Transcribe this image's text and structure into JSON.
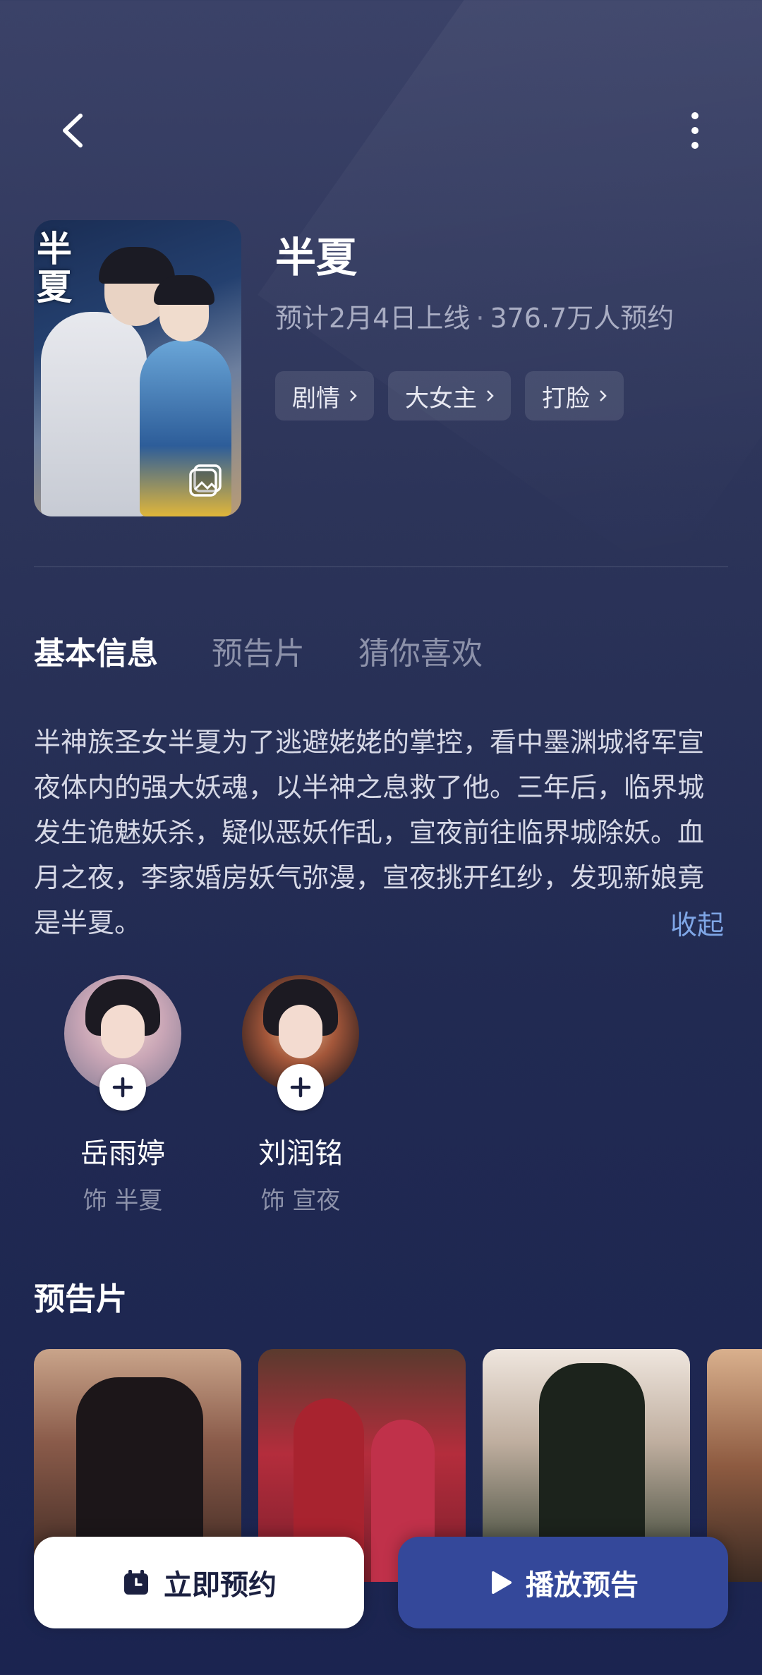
{
  "header": {
    "back_icon": "chevron-left-icon",
    "more_icon": "more-vertical-icon"
  },
  "show": {
    "poster_title": "半夏",
    "title": "半夏",
    "release": "预计2月4日上线",
    "separator": "·",
    "reservations": "376.7万人预约",
    "tags": [
      {
        "label": "剧情"
      },
      {
        "label": "大女主"
      },
      {
        "label": "打脸"
      }
    ]
  },
  "tabs": [
    {
      "label": "基本信息",
      "active": true
    },
    {
      "label": "预告片",
      "active": false
    },
    {
      "label": "猜你喜欢",
      "active": false
    }
  ],
  "synopsis": {
    "text": "半神族圣女半夏为了逃避姥姥的掌控，看中墨渊城将军宣夜体内的强大妖魂，以半神之息救了他。三年后，临界城发生诡魅妖杀，疑似恶妖作乱，宣夜前往临界城除妖。血月之夜，李家婚房妖气弥漫，宣夜挑开红纱，发现新娘竟是半夏。",
    "collapse_label": "收起"
  },
  "cast": [
    {
      "name": "岳雨婷",
      "role": "饰 半夏"
    },
    {
      "name": "刘润铭",
      "role": "饰 宣夜"
    }
  ],
  "trailers": {
    "title": "预告片"
  },
  "actions": {
    "reserve_label": "立即预约",
    "play_label": "播放预告"
  },
  "colors": {
    "background": "#2c3459",
    "accent": "#34489a",
    "link": "#7fa6e6"
  }
}
